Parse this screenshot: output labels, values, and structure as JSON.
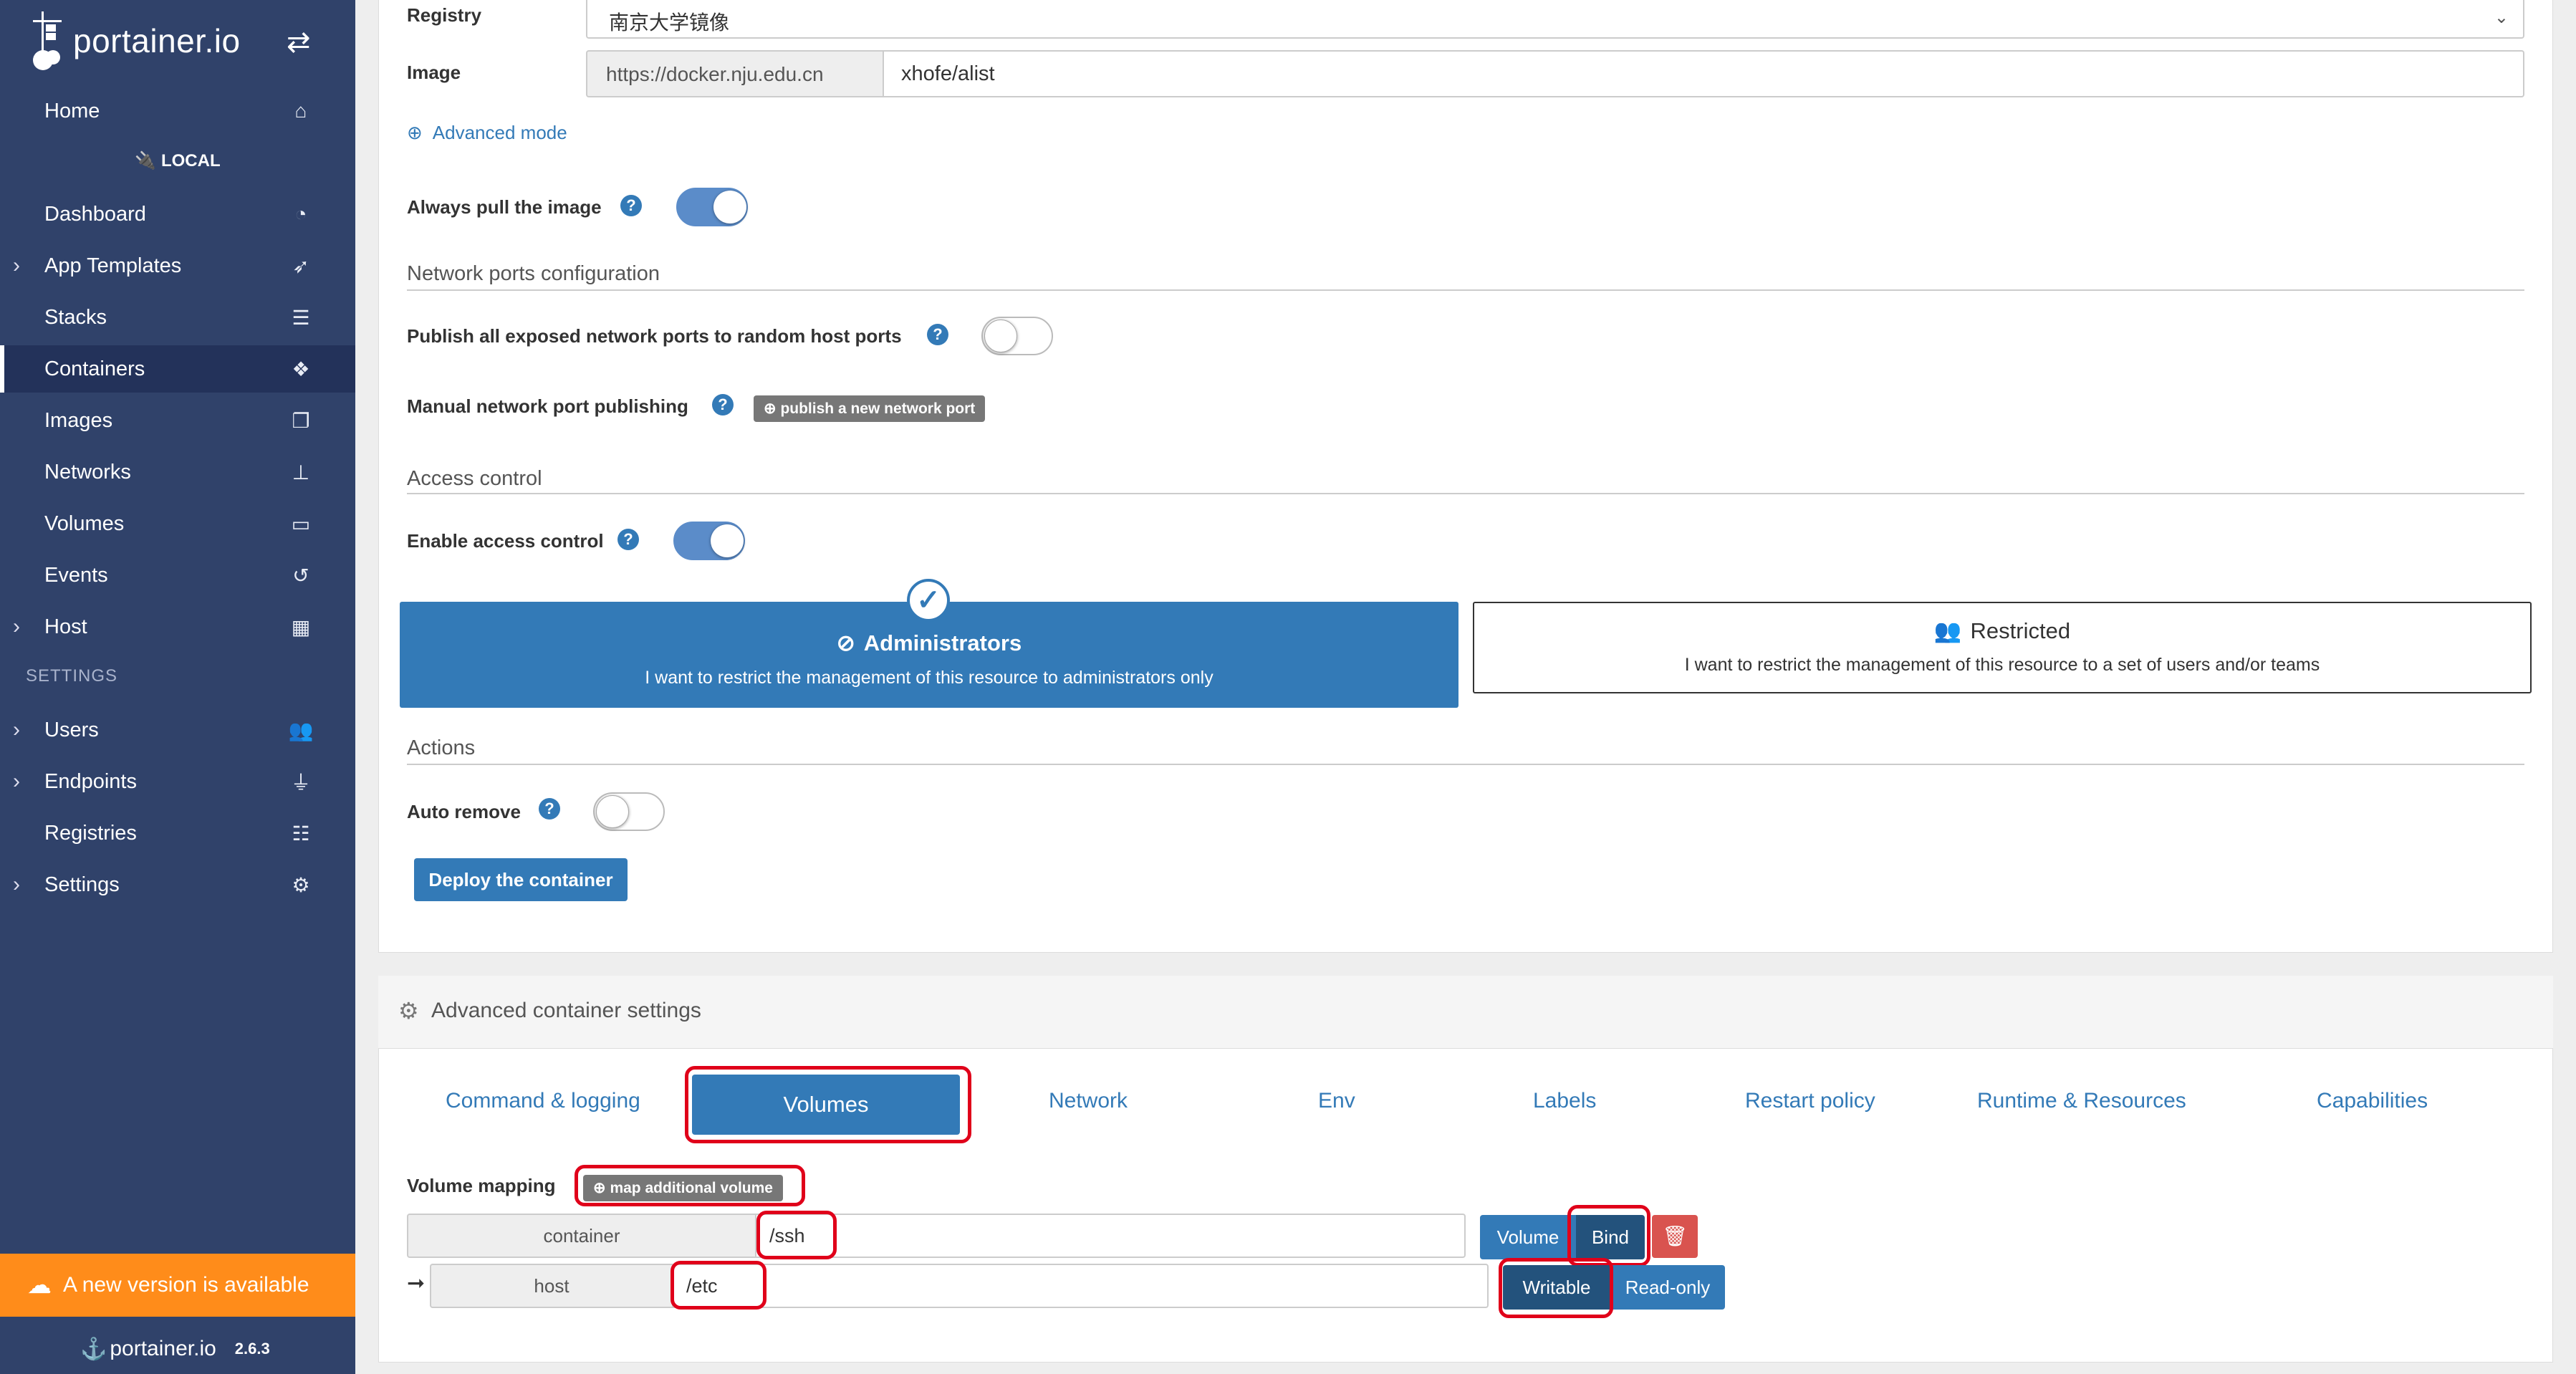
{
  "app": {
    "logo_text": "portainer.io",
    "version": "2.6.3"
  },
  "sidebar": {
    "local_label": "LOCAL",
    "settings_label": "SETTINGS",
    "items": [
      {
        "label": "Home",
        "icon": "home-icon",
        "expandable": false
      },
      {
        "label": "Dashboard",
        "icon": "tachometer-icon",
        "expandable": false
      },
      {
        "label": "App Templates",
        "icon": "rocket-icon",
        "expandable": true
      },
      {
        "label": "Stacks",
        "icon": "th-list-icon",
        "expandable": false
      },
      {
        "label": "Containers",
        "icon": "cubes-icon",
        "expandable": false,
        "active": true
      },
      {
        "label": "Images",
        "icon": "clone-icon",
        "expandable": false
      },
      {
        "label": "Networks",
        "icon": "sitemap-icon",
        "expandable": false
      },
      {
        "label": "Volumes",
        "icon": "hdd-icon",
        "expandable": false
      },
      {
        "label": "Events",
        "icon": "history-icon",
        "expandable": false
      },
      {
        "label": "Host",
        "icon": "th-icon",
        "expandable": true
      },
      {
        "label": "Users",
        "icon": "users-icon",
        "expandable": true
      },
      {
        "label": "Endpoints",
        "icon": "plug-icon",
        "expandable": true
      },
      {
        "label": "Registries",
        "icon": "database-icon",
        "expandable": false
      },
      {
        "label": "Settings",
        "icon": "cogs-icon",
        "expandable": true
      }
    ],
    "new_version": "A new version is available"
  },
  "form": {
    "registry_label": "Registry",
    "registry_value": "南京大学镜像",
    "image_label": "Image",
    "image_prefix": "https://docker.nju.edu.cn",
    "image_value": "xhofe/alist",
    "advanced_mode": "Advanced mode",
    "always_pull_label": "Always pull the image",
    "always_pull": true,
    "ports_title": "Network ports configuration",
    "publish_all_label": "Publish all exposed network ports to random host ports",
    "publish_all": false,
    "manual_publish_label": "Manual network port publishing",
    "publish_button": "publish a new network port",
    "access_title": "Access control",
    "enable_access_label": "Enable access control",
    "enable_access": true,
    "admin_title": "Administrators",
    "admin_desc": "I want to restrict the management of this resource to administrators only",
    "restricted_title": "Restricted",
    "restricted_desc": "I want to restrict the management of this resource to a set of users and/or teams",
    "actions_title": "Actions",
    "auto_remove_label": "Auto remove",
    "auto_remove": false,
    "deploy_button": "Deploy the container"
  },
  "advanced": {
    "title": "Advanced container settings",
    "tabs": [
      "Command & logging",
      "Volumes",
      "Network",
      "Env",
      "Labels",
      "Restart policy",
      "Runtime & Resources",
      "Capabilities"
    ],
    "active_tab": "Volumes",
    "volume_mapping_label": "Volume mapping",
    "map_button": "map additional volume",
    "container_label": "container",
    "container_value": "/ssh",
    "host_label": "host",
    "host_value": "/etc",
    "volume_btn": "Volume",
    "bind_btn": "Bind",
    "writable_btn": "Writable",
    "readonly_btn": "Read-only"
  },
  "colors": {
    "sidebar": "#30426a",
    "primary": "#337ab7",
    "orange": "#ff8c1a",
    "highlight": "#e0001a",
    "danger": "#d9534f"
  }
}
